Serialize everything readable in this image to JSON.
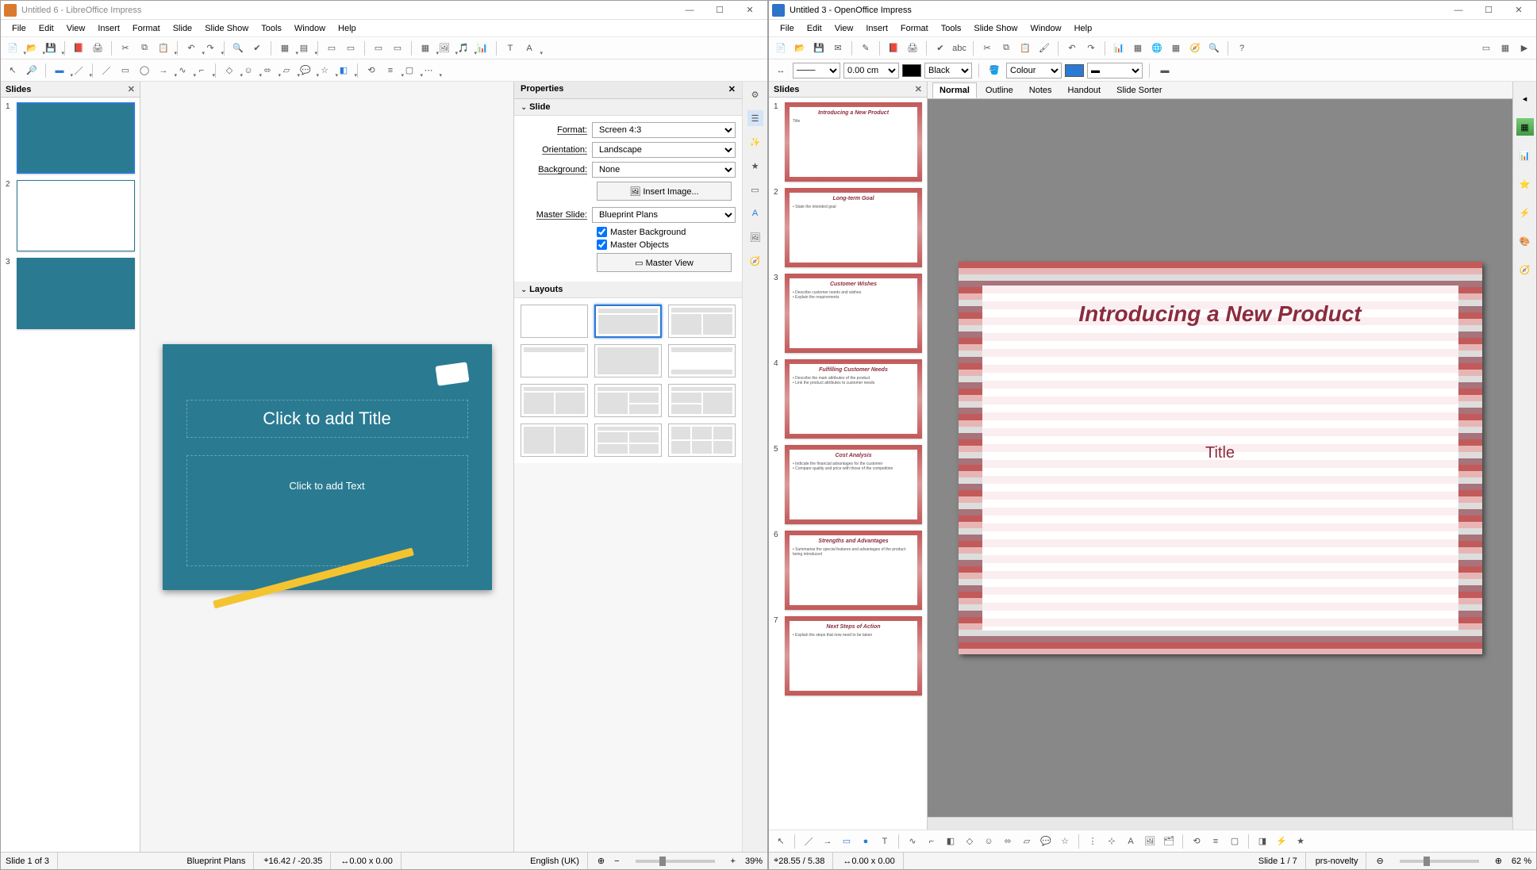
{
  "libre": {
    "title": "Untitled 6 - LibreOffice Impress",
    "menu": [
      "File",
      "Edit",
      "View",
      "Insert",
      "Format",
      "Slide",
      "Slide Show",
      "Tools",
      "Window",
      "Help"
    ],
    "slides_label": "Slides",
    "properties_label": "Properties",
    "section_slide": "Slide",
    "section_layouts": "Layouts",
    "form": {
      "format_label": "Format:",
      "format_value": "Screen 4:3",
      "orientation_label": "Orientation:",
      "orientation_value": "Landscape",
      "background_label": "Background:",
      "background_value": "None",
      "insert_image": "Insert Image...",
      "master_slide_label": "Master Slide:",
      "master_slide_value": "Blueprint Plans",
      "master_bg": "Master Background",
      "master_obj": "Master Objects",
      "master_view": "Master View"
    },
    "canvas": {
      "title_ph": "Click to add Title",
      "text_ph": "Click to add Text"
    },
    "status": {
      "slide": "Slide 1 of 3",
      "master": "Blueprint Plans",
      "coords": "16.42 / -20.35",
      "size": "0.00 x 0.00",
      "lang": "English (UK)",
      "zoom": "39%"
    },
    "thumbs": [
      {
        "num": "1",
        "cls": "blueprint",
        "selected": true
      },
      {
        "num": "2",
        "cls": "white-bp",
        "selected": false
      },
      {
        "num": "3",
        "cls": "blueprint",
        "selected": false
      }
    ]
  },
  "oo": {
    "title": "Untitled 3 - OpenOffice Impress",
    "menu": [
      "File",
      "Edit",
      "View",
      "Insert",
      "Format",
      "Tools",
      "Slide Show",
      "Window",
      "Help"
    ],
    "slides_label": "Slides",
    "tb2": {
      "width": "0.00 cm",
      "linecolor": "Black",
      "fillmode": "Colour",
      "fillcolor_hex": "#2a7ad4"
    },
    "viewtabs": [
      "Normal",
      "Outline",
      "Notes",
      "Handout",
      "Slide Sorter"
    ],
    "active_view": "Normal",
    "canvas": {
      "title": "Introducing a New Product",
      "subtitle": "Title"
    },
    "thumbs": [
      {
        "num": "1",
        "title": "Introducing a New Product",
        "body": "Title",
        "selected": true
      },
      {
        "num": "2",
        "title": "Long-term Goal",
        "body": "• State the intended goal",
        "selected": false
      },
      {
        "num": "3",
        "title": "Customer Wishes",
        "body": "• Describe customer needs and wishes\n• Explain the requirements",
        "selected": false
      },
      {
        "num": "4",
        "title": "Fulfilling Customer Needs",
        "body": "• Describe the main attributes of the product\n• Link the product attributes to customer needs",
        "selected": false
      },
      {
        "num": "5",
        "title": "Cost Analysis",
        "body": "• Indicate the financial advantages for the customer\n• Compare quality and price with those of the competition",
        "selected": false
      },
      {
        "num": "6",
        "title": "Strengths and Advantages",
        "body": "• Summarise the special features and advantages of the product being introduced",
        "selected": false
      },
      {
        "num": "7",
        "title": "Next Steps of Action",
        "body": "• Explain the steps that now need to be taken",
        "selected": false
      }
    ],
    "status": {
      "coords": "28.55 / 5.38",
      "size": "0.00 x 0.00",
      "slide": "Slide 1 / 7",
      "master": "prs-novelty",
      "zoom": "62 %"
    }
  }
}
